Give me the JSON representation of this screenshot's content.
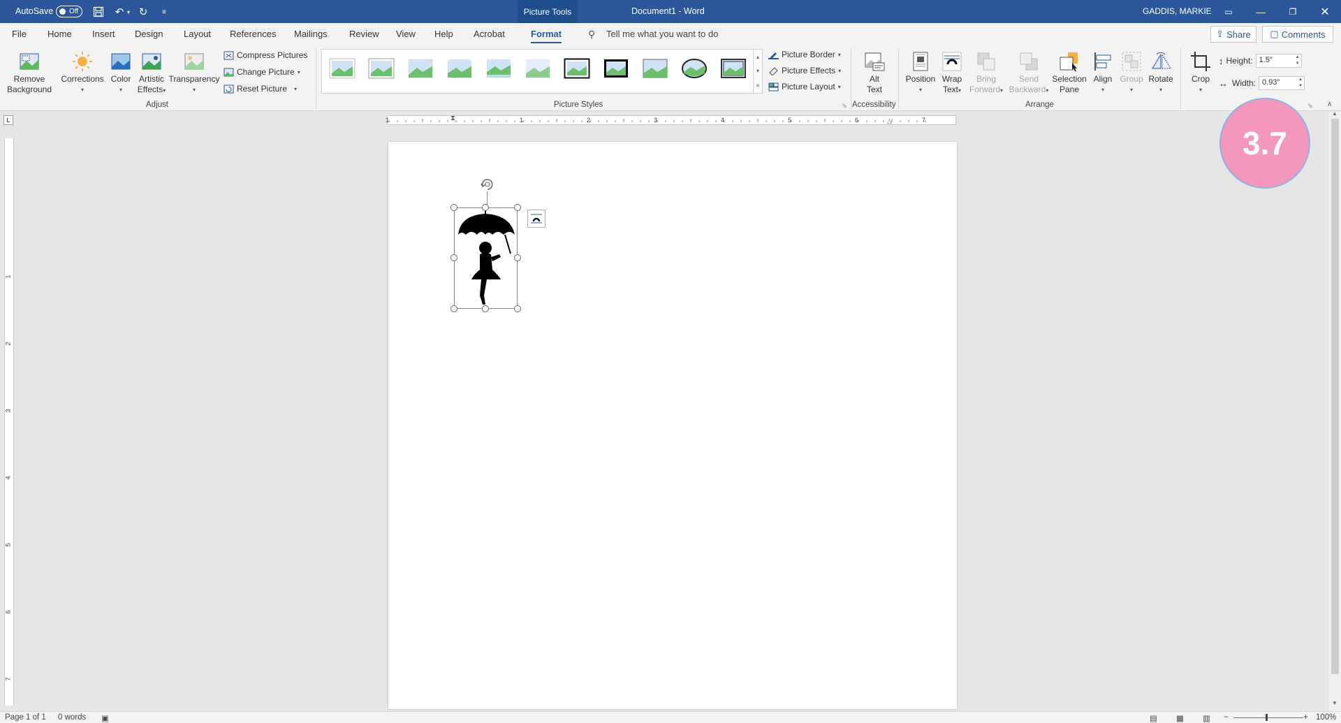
{
  "titlebar": {
    "autosave_label": "AutoSave",
    "autosave_state": "Off",
    "context_tab": "Picture Tools",
    "doc_title": "Document1 - Word",
    "user": "GADDIS, MARKIE"
  },
  "tabs": [
    "File",
    "Home",
    "Insert",
    "Design",
    "Layout",
    "References",
    "Mailings",
    "Review",
    "View",
    "Help",
    "Acrobat",
    "Format"
  ],
  "active_tab": "Format",
  "tell_me": "Tell me what you want to do",
  "share_label": "Share",
  "comments_label": "Comments",
  "adjust": {
    "remove_bg_1": "Remove",
    "remove_bg_2": "Background",
    "corrections": "Corrections",
    "color": "Color",
    "artistic_1": "Artistic",
    "artistic_2": "Effects",
    "transparency": "Transparency",
    "compress": "Compress Pictures",
    "change": "Change Picture",
    "reset": "Reset Picture",
    "label": "Adjust"
  },
  "picture_styles": {
    "border": "Picture Border",
    "effects": "Picture Effects",
    "layout": "Picture Layout",
    "label": "Picture Styles"
  },
  "accessibility": {
    "alt_1": "Alt",
    "alt_2": "Text",
    "label": "Accessibility"
  },
  "arrange": {
    "position": "Position",
    "wrap_1": "Wrap",
    "wrap_2": "Text",
    "bring_1": "Bring",
    "bring_2": "Forward",
    "send_1": "Send",
    "send_2": "Backward",
    "selection_1": "Selection",
    "selection_2": "Pane",
    "align": "Align",
    "group": "Group",
    "rotate": "Rotate",
    "label": "Arrange"
  },
  "size": {
    "crop": "Crop",
    "height_label": "Height:",
    "height_value": "1.5\"",
    "width_label": "Width:",
    "width_value": "0.93\""
  },
  "ruler_numbers": [
    "1",
    "1",
    "2",
    "3",
    "4",
    "5",
    "6",
    "7"
  ],
  "vruler_numbers": [
    "1",
    "1",
    "2",
    "3",
    "4",
    "5",
    "6",
    "7"
  ],
  "status": {
    "page": "Page 1 of 1",
    "words": "0 words",
    "zoom": "100%"
  },
  "badge": "3.7",
  "colors": {
    "titlebar": "#2b579a",
    "badge": "#f497bd"
  }
}
